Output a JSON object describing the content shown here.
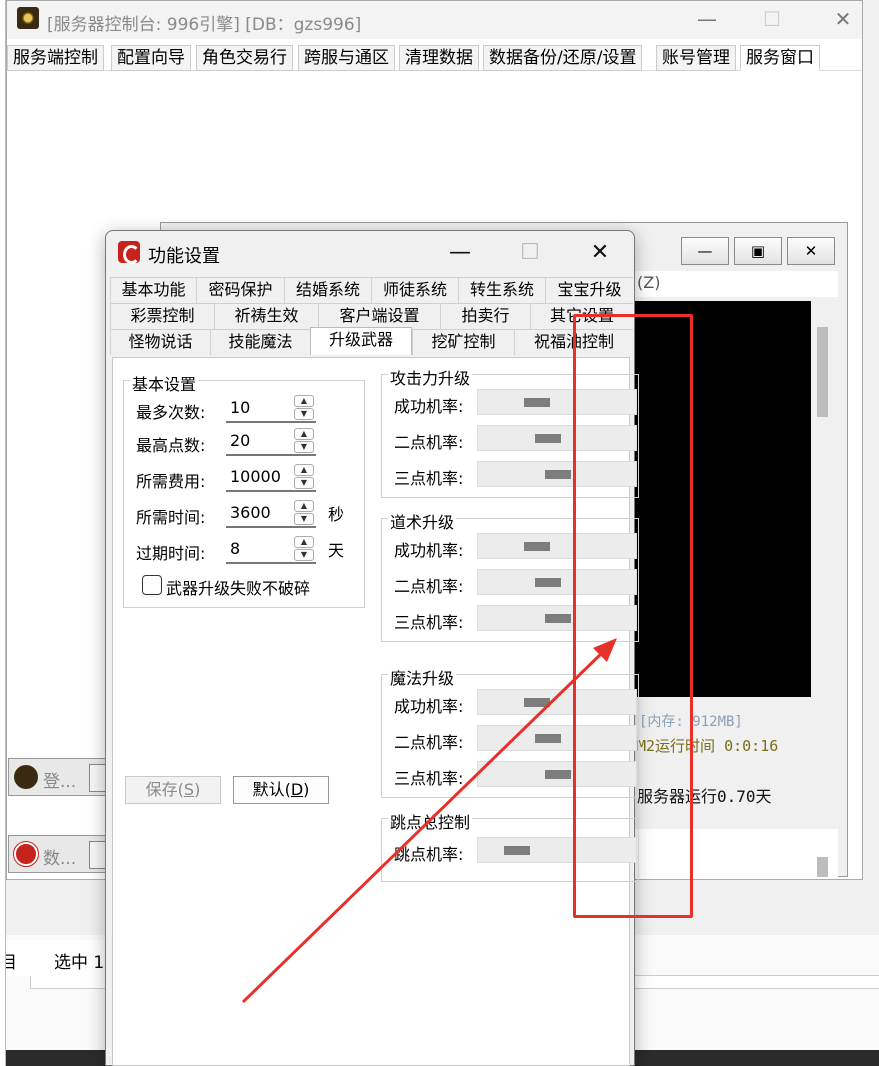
{
  "main_window": {
    "title": "[服务器控制台: 996引擎] [DB：gzs996]",
    "min": "—",
    "max": "☐",
    "close": "✕",
    "menu": [
      "服务端控制",
      "配置向导",
      "角色交易行",
      "跨服与通区",
      "清理数据",
      "数据备份/还原/设置",
      "账号管理",
      "服务窗口"
    ]
  },
  "console": {
    "min": "—",
    "max": "▣",
    "close": "✕",
    "z_label": "(Z)",
    "memory": "[内存: 912MB]",
    "m2_runtime": "M2运行时间 0:0:16",
    "server_runtime": "服务器运行0.70天"
  },
  "side_tasks": [
    {
      "label": "登..."
    },
    {
      "label": "数..."
    }
  ],
  "status_bar": {
    "left": "目",
    "selected": "选中 1"
  },
  "dialog": {
    "title": "功能设置",
    "min": "—",
    "max": "☐",
    "close": "✕",
    "tabs_row1": [
      "基本功能",
      "密码保护",
      "结婚系统",
      "师徒系统",
      "转生系统",
      "宝宝升级"
    ],
    "tabs_row2": [
      "彩票控制",
      "祈祷生效",
      "客户端设置",
      "拍卖行",
      "其它设置"
    ],
    "tabs_row3": [
      "怪物说话",
      "技能魔法",
      "升级武器",
      "挖矿控制",
      "祝福油控制"
    ],
    "active_tab": "升级武器",
    "basic_group": {
      "title": "基本设置",
      "rows": [
        {
          "label": "最多次数:",
          "value": "10",
          "unit": ""
        },
        {
          "label": "最高点数:",
          "value": "20",
          "unit": ""
        },
        {
          "label": "所需费用:",
          "value": "10000",
          "unit": ""
        },
        {
          "label": "所需时间:",
          "value": "3600",
          "unit": "秒"
        },
        {
          "label": "过期时间:",
          "value": "8",
          "unit": "天"
        }
      ],
      "checkbox_label": "武器升级失败不破碎",
      "checkbox_checked": false
    },
    "rate_groups": [
      {
        "title": "攻击力升级",
        "rows": [
          {
            "label": "成功机率:",
            "level": 0.35
          },
          {
            "label": "二点机率:",
            "level": 0.43
          },
          {
            "label": "三点机率:",
            "level": 0.51
          }
        ]
      },
      {
        "title": "道术升级",
        "rows": [
          {
            "label": "成功机率:",
            "level": 0.35
          },
          {
            "label": "二点机率:",
            "level": 0.43
          },
          {
            "label": "三点机率:",
            "level": 0.51
          }
        ]
      },
      {
        "title": "魔法升级",
        "rows": [
          {
            "label": "成功机率:",
            "level": 0.35
          },
          {
            "label": "二点机率:",
            "level": 0.43
          },
          {
            "label": "三点机率:",
            "level": 0.51
          }
        ]
      },
      {
        "title": "跳点总控制",
        "rows": [
          {
            "label": "跳点机率:",
            "level": 0.2
          }
        ]
      }
    ],
    "save_button": {
      "text": "保存(",
      "key": "S",
      "close": ")"
    },
    "default_button": {
      "text": "默认(",
      "key": "D",
      "close": ")"
    }
  },
  "colors": {
    "annotation": "#e8302a",
    "slider_thumb": "#7d7d7d"
  }
}
